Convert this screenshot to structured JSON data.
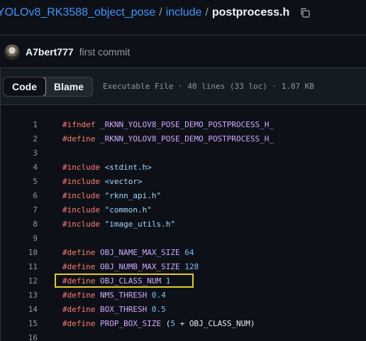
{
  "breadcrumb": {
    "repo": "YOLOv8_RK3588_object_pose",
    "sep1": "/",
    "dir": "include",
    "sep2": "/",
    "file": "postprocess.h",
    "copy_icon": "copy-icon"
  },
  "commit": {
    "author": "A7bert777",
    "message": "first commit"
  },
  "file_header": {
    "code_tab": "Code",
    "blame_tab": "Blame",
    "meta": "Executable File · 40 lines (33 loc) · 1.07 KB"
  },
  "code": {
    "lines": [
      {
        "n": "1",
        "pre": "#",
        "kw": "ifndef",
        "rest": " _RKNN_YOLOV8_POSE_DEMO_POSTPROCESS_H_"
      },
      {
        "n": "2",
        "pre": "#",
        "kw": "define",
        "rest": " _RKNN_YOLOV8_POSE_DEMO_POSTPROCESS_H_"
      },
      {
        "n": "3",
        "pre": "",
        "kw": "",
        "rest": ""
      },
      {
        "n": "4",
        "pre": "#",
        "kw": "include",
        "rest": " <stdint.h>"
      },
      {
        "n": "5",
        "pre": "#",
        "kw": "include",
        "rest": " <vector>"
      },
      {
        "n": "6",
        "pre": "#",
        "kw": "include",
        "rest": " \"rknn_api.h\""
      },
      {
        "n": "7",
        "pre": "#",
        "kw": "include",
        "rest": " \"common.h\""
      },
      {
        "n": "8",
        "pre": "#",
        "kw": "include",
        "rest": " \"image_utils.h\""
      },
      {
        "n": "9",
        "pre": "",
        "kw": "",
        "rest": ""
      },
      {
        "n": "10",
        "pre": "#",
        "kw": "define",
        "name": "OBJ_NAME_MAX_SIZE",
        "val": "64"
      },
      {
        "n": "11",
        "pre": "#",
        "kw": "define",
        "name": "OBJ_NUMB_MAX_SIZE",
        "val": "128"
      },
      {
        "n": "12",
        "pre": "#",
        "kw": "define",
        "name": "OBJ_CLASS_NUM",
        "val": "1",
        "highlighted": true
      },
      {
        "n": "13",
        "pre": "#",
        "kw": "define",
        "name": "NMS_THRESH",
        "val": "0.4"
      },
      {
        "n": "14",
        "pre": "#",
        "kw": "define",
        "name": "BOX_THRESH",
        "val": "0.5"
      },
      {
        "n": "15",
        "pre": "#",
        "kw": "define",
        "name": "PROP_BOX_SIZE",
        "val": "(5 + OBJ_CLASS_NUM)"
      },
      {
        "n": "16",
        "pre": "",
        "kw": "",
        "rest": ""
      }
    ]
  },
  "colors": {
    "link": "#4493f8",
    "keyword": "#ff7b72",
    "macro": "#d2a8ff",
    "string": "#a5d6ff",
    "number": "#79c0ff",
    "highlight_box": "#e3c82b"
  }
}
